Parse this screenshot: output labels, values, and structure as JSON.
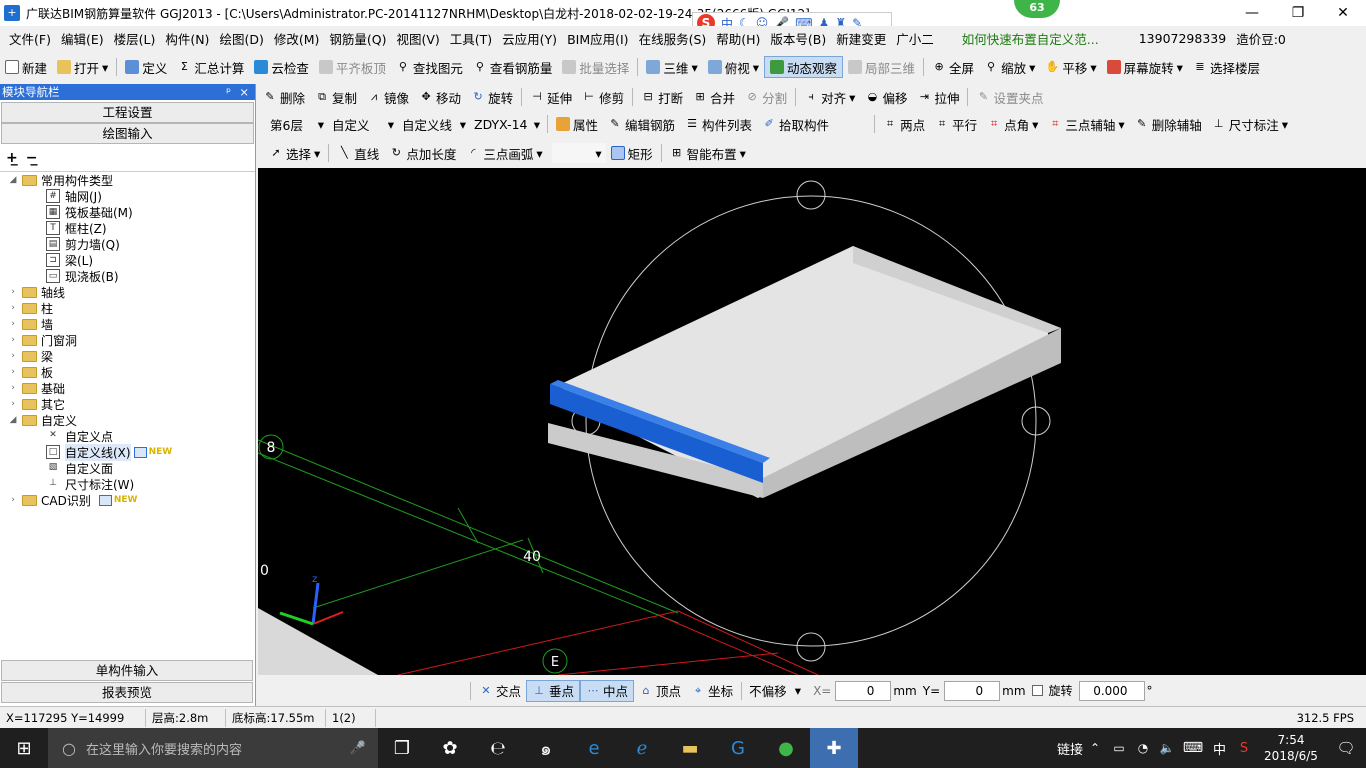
{
  "window": {
    "title": "广联达BIM钢筋算量软件 GGJ2013 - [C:\\Users\\Administrator.PC-20141127NRHM\\Desktop\\白龙村-2018-02-02-19-24-35(2666版).GGJ12]",
    "minimize": "—",
    "maximize": "❐",
    "close": "✕"
  },
  "notification_badge": "63",
  "ime_bar": {
    "logo": "S",
    "mode": "中"
  },
  "menu": {
    "items": [
      "文件(F)",
      "编辑(E)",
      "楼层(L)",
      "构件(N)",
      "绘图(D)",
      "修改(M)",
      "钢筋量(Q)",
      "视图(V)",
      "工具(T)",
      "云应用(Y)",
      "BIM应用(I)",
      "在线服务(S)",
      "帮助(H)",
      "版本号(B)",
      "新建变更",
      "广小二"
    ],
    "tip": "如何快速布置自定义范...",
    "phone": "13907298339",
    "beans": "造价豆:0"
  },
  "toolbar1": {
    "new": "新建",
    "open": "打开",
    "define": "定义",
    "sum": "汇总计算",
    "cloud_check": "云检查",
    "align_top": "平齐板顶",
    "find": "查找图元",
    "view_rebar": "查看钢筋量",
    "batch_select": "批量选择",
    "three_d": "三维",
    "top_view": "俯视",
    "dynamic": "动态观察",
    "local_3d": "局部三维",
    "fullscreen": "全屏",
    "zoom": "缩放",
    "pan": "平移",
    "rotate": "屏幕旋转",
    "select_floor": "选择楼层"
  },
  "toolbar2": {
    "delete": "删除",
    "copy": "复制",
    "mirror": "镜像",
    "move": "移动",
    "rotate": "旋转",
    "extend": "延伸",
    "trim": "修剪",
    "break": "打断",
    "merge": "合并",
    "split": "分割",
    "align": "对齐",
    "offset": "偏移",
    "stretch": "拉伸",
    "set_grip": "设置夹点"
  },
  "toolbar3": {
    "floor": "第6层",
    "category": "自定义",
    "type": "自定义线",
    "name": "ZDYX-14",
    "props": "属性",
    "edit_rebar": "编辑钢筋",
    "list": "构件列表",
    "pick": "拾取构件",
    "two_point": "两点",
    "parallel": "平行",
    "point_angle": "点角",
    "three_point_axis": "三点辅轴",
    "del_axis": "删除辅轴",
    "dim": "尺寸标注"
  },
  "toolbar4": {
    "select": "选择",
    "line": "直线",
    "point_len": "点加长度",
    "arc": "三点画弧",
    "rect": "矩形",
    "smart": "智能布置"
  },
  "panel": {
    "header": "模块导航栏",
    "pin": "ᵖ",
    "close": "×",
    "project_settings": "工程设置",
    "drawing_input": "绘图输入",
    "single_input": "单构件输入",
    "report_preview": "报表预览"
  },
  "tree": {
    "common": "常用构件类型",
    "common_items": [
      {
        "label": "轴网(J)",
        "icon": "grid-icon",
        "glyph": "#"
      },
      {
        "label": "筏板基础(M)",
        "icon": "raft-icon",
        "glyph": "▦"
      },
      {
        "label": "框柱(Z)",
        "icon": "column-icon",
        "glyph": "T"
      },
      {
        "label": "剪力墙(Q)",
        "icon": "wall-icon",
        "glyph": "▤"
      },
      {
        "label": "梁(L)",
        "icon": "beam-icon",
        "glyph": "⊐"
      },
      {
        "label": "现浇板(B)",
        "icon": "slab-icon",
        "glyph": "▭"
      }
    ],
    "folders": [
      "轴线",
      "柱",
      "墙",
      "门窗洞",
      "梁",
      "板",
      "基础",
      "其它"
    ],
    "custom": "自定义",
    "custom_items": [
      {
        "label": "自定义点",
        "icon": "x-point-icon",
        "glyph": "✕"
      },
      {
        "label": "自定义线(X)",
        "icon": "custom-line-icon",
        "glyph": "□"
      },
      {
        "label": "自定义面",
        "icon": "hatch-icon",
        "glyph": "▧"
      },
      {
        "label": "尺寸标注(W)",
        "icon": "dimension-icon",
        "glyph": "⊥"
      }
    ],
    "cad": "CAD识别",
    "new_tag": "NEW"
  },
  "viewport": {
    "axis_8": "8",
    "axis_e": "E",
    "dim_40": "40",
    "axis_0": "0",
    "colors": {
      "bg": "#000000",
      "slab": "#d9d9d9",
      "edge": "#1a5fd1",
      "grid_green": "#1e9e1e",
      "grid_red": "#d21a1a"
    }
  },
  "snapbar": {
    "intersect": "交点",
    "perp": "垂点",
    "mid": "中点",
    "vertex": "顶点",
    "coord": "坐标",
    "offset_mode": "不偏移",
    "x_label": "X=",
    "x_val": "0",
    "mm1": "mm",
    "y_label": "Y=",
    "y_val": "0",
    "mm2": "mm",
    "rotate": "旋转",
    "rot_val": "0.000",
    "deg": "°"
  },
  "status": {
    "coords": "X=117295 Y=14999",
    "floor_h": "层高:2.8m",
    "base_h": "底标高:17.55m",
    "count": "1(2)",
    "fps": "312.5 FPS"
  },
  "taskbar": {
    "search_placeholder": "在这里输入你要搜索的内容",
    "link": "链接",
    "ime": "中",
    "time": "7:54",
    "date": "2018/6/5"
  }
}
